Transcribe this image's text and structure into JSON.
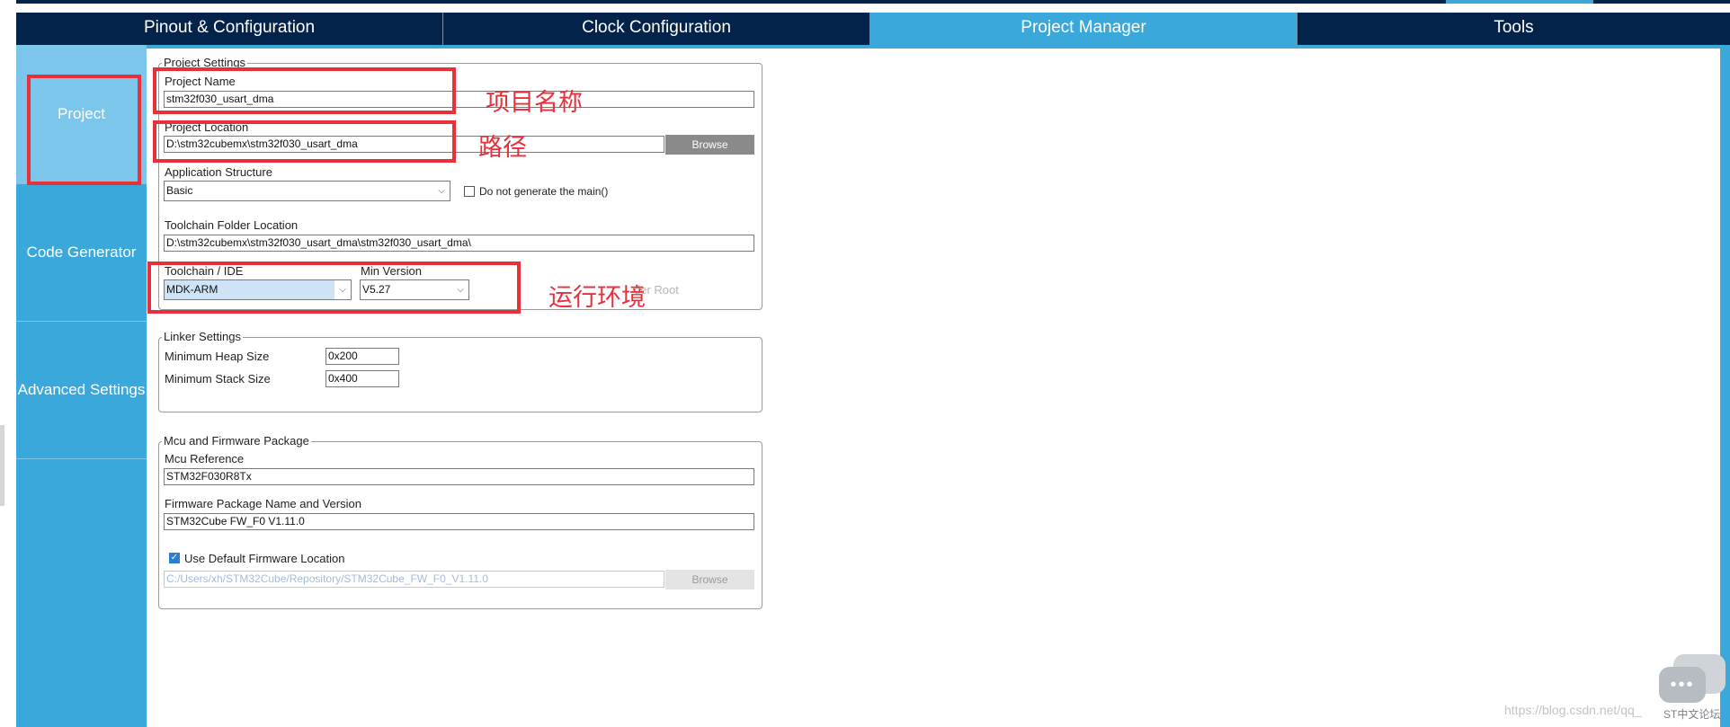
{
  "tabs": [
    {
      "label": "Pinout & Configuration"
    },
    {
      "label": "Clock Configuration"
    },
    {
      "label": "Project Manager"
    },
    {
      "label": "Tools"
    }
  ],
  "sidenav": {
    "items": [
      {
        "label": "Project"
      },
      {
        "label": "Code Generator"
      },
      {
        "label": "Advanced Settings"
      }
    ]
  },
  "project_settings": {
    "legend": "Project Settings",
    "project_name_label": "Project Name",
    "project_name_value": "stm32f030_usart_dma",
    "project_location_label": "Project Location",
    "project_location_value": "D:\\stm32cubemx\\stm32f030_usart_dma",
    "browse_label": "Browse",
    "app_structure_label": "Application Structure",
    "app_structure_value": "Basic",
    "no_main_label": "Do not generate the main()",
    "toolchain_folder_label": "Toolchain Folder Location",
    "toolchain_folder_value": "D:\\stm32cubemx\\stm32f030_usart_dma\\stm32f030_usart_dma\\",
    "toolchain_ide_label": "Toolchain / IDE",
    "toolchain_ide_value": "MDK-ARM",
    "min_version_label": "Min Version",
    "min_version_value": "V5.27",
    "generate_under_root_label": "der Root"
  },
  "linker_settings": {
    "legend": "Linker Settings",
    "heap_label": "Minimum Heap Size",
    "heap_value": "0x200",
    "stack_label": "Minimum Stack Size",
    "stack_value": "0x400"
  },
  "mcu_package": {
    "legend": "Mcu and Firmware Package",
    "mcu_ref_label": "Mcu Reference",
    "mcu_ref_value": "STM32F030R8Tx",
    "fw_label": "Firmware Package Name and Version",
    "fw_value": "STM32Cube FW_F0 V1.11.0",
    "use_default_label": "Use Default Firmware Location",
    "use_default_checked": true,
    "fw_location_value": "C:/Users/xh/STM32Cube/Repository/STM32Cube_FW_F0_V1.11.0",
    "browse_label": "Browse"
  },
  "annotations": {
    "project_name": "项目名称",
    "path": "路径",
    "runtime_env": "运行环境"
  },
  "overlay": {
    "watermark": "https://blog.csdn.net/qq_",
    "forum_label": "ST中文论坛"
  },
  "colors": {
    "nav_dark": "#03234b",
    "accent_blue": "#3ba8dc",
    "annotation_red": "#e8303a"
  }
}
